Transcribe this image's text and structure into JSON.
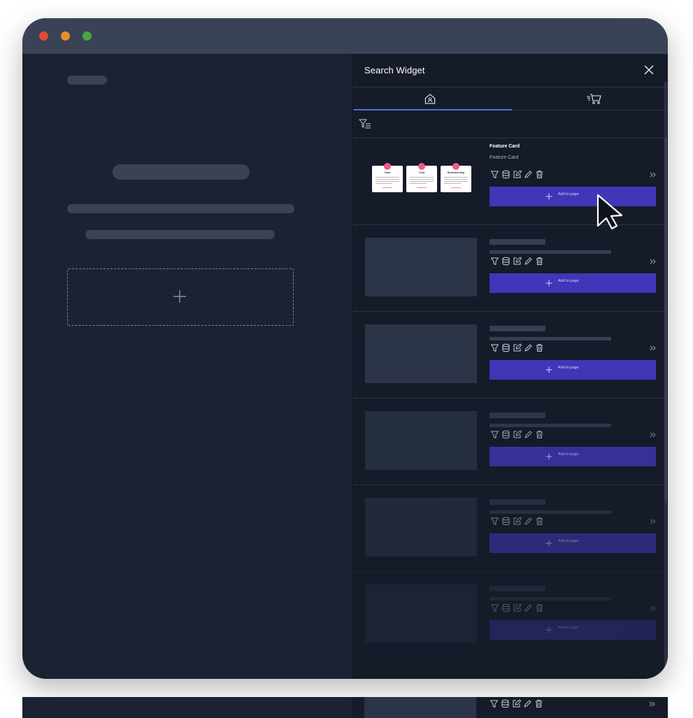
{
  "window": {
    "controls": [
      "close",
      "minimize",
      "maximize"
    ]
  },
  "panel": {
    "title": "Search Widget",
    "tabs": [
      {
        "name": "home",
        "icon": "home-user-icon",
        "active": true
      },
      {
        "name": "store",
        "icon": "cart-icon",
        "active": false
      }
    ],
    "filter_icon": "filter-list-icon",
    "tools": [
      "filter-icon",
      "database-icon",
      "edit-square-icon",
      "pencil-icon",
      "trash-icon"
    ],
    "cards": [
      {
        "title": "Feature Card",
        "subtitle": "Feature Card",
        "add_label": "Add to page",
        "preview": [
          {
            "title": "Team"
          },
          {
            "title": "Chat"
          },
          {
            "title": "Brainstorming"
          }
        ]
      },
      {
        "add_label": "Add to page"
      },
      {
        "add_label": "Add to page"
      },
      {
        "add_label": "Add to page"
      },
      {
        "add_label": "Add to page"
      },
      {
        "add_label": "Add to page"
      }
    ]
  },
  "colors": {
    "accent": "#4136b8",
    "panel_bg": "#151b29",
    "canvas_bg": "#1b2231",
    "titlebar": "#394355",
    "dot_red": "#e04b32",
    "dot_orange": "#e68e2b",
    "dot_green": "#4fa447"
  }
}
